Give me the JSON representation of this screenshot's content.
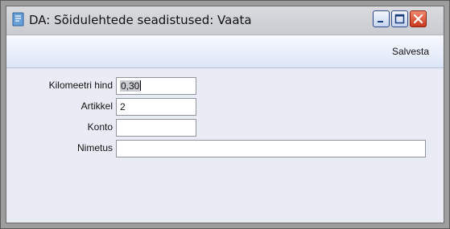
{
  "window": {
    "title": "DA: Sõidulehtede seadistused: Vaata",
    "icons": {
      "app": "app-doc-icon",
      "minimize": "minimize-icon",
      "maximize": "maximize-icon",
      "close": "close-icon"
    }
  },
  "toolbar": {
    "save_label": "Salvesta"
  },
  "form": {
    "fields": [
      {
        "label": "Kilomeetri hind",
        "value": "0,30"
      },
      {
        "label": "Artikkel",
        "value": "2"
      },
      {
        "label": "Konto",
        "value": ""
      },
      {
        "label": "Nimetus",
        "value": ""
      }
    ]
  },
  "colors": {
    "close_button": "#c9371d",
    "content_bg": "#e9ecf4",
    "toolbar_bg": "#dde6f7"
  }
}
